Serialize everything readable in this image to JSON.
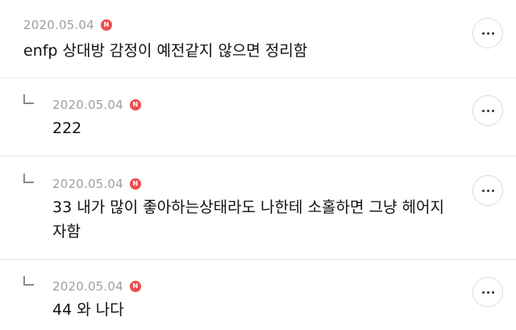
{
  "comments": [
    {
      "date": "2020.05.04",
      "badge": "N",
      "text": "enfp 상대방 감정이 예전같지 않으면 정리함",
      "is_reply": false,
      "more_icon": "more-horizontal-icon"
    },
    {
      "date": "2020.05.04",
      "badge": "N",
      "text": "222",
      "is_reply": true,
      "more_icon": "more-horizontal-icon"
    },
    {
      "date": "2020.05.04",
      "badge": "N",
      "text": "33 내가 많이 좋아하는상태라도 나한테 소홀하면 그냥 헤어지\n자함",
      "is_reply": true,
      "more_icon": "more-horizontal-icon"
    },
    {
      "date": "2020.05.04",
      "badge": "N",
      "text": "44 와 나다",
      "is_reply": true,
      "more_icon": "more-horizontal-icon"
    }
  ],
  "colors": {
    "badge": "#ee4d4d",
    "date": "#9e9e9e",
    "divider": "#e6e6e6"
  }
}
